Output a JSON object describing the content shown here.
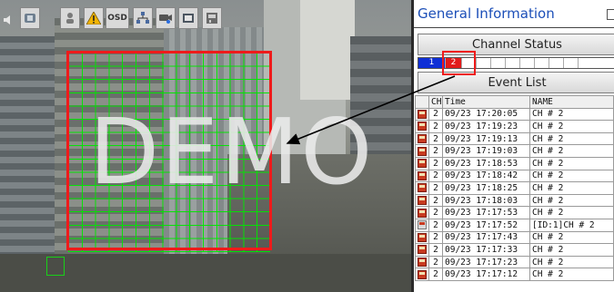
{
  "toolbar": {
    "buttons": [
      {
        "name": "dvr-icon"
      },
      {
        "name": "person-icon"
      },
      {
        "name": "alarm-warning-icon"
      },
      {
        "name": "osd-button",
        "label": "OSD"
      },
      {
        "name": "network-icon"
      },
      {
        "name": "ptz-camera-icon"
      },
      {
        "name": "playback-icon"
      },
      {
        "name": "audio-device-icon"
      }
    ]
  },
  "video": {
    "watermark": "DEMO"
  },
  "panel": {
    "title": "General Information",
    "channel_status": {
      "heading": "Channel Status",
      "channels": [
        "1",
        "2"
      ]
    },
    "event_list": {
      "heading": "Event List",
      "columns": [
        "CH",
        "Time",
        "NAME"
      ],
      "rows": [
        {
          "ch": "2",
          "time": "09/23 17:20:05",
          "name": "CH # 2",
          "icon": "motion"
        },
        {
          "ch": "2",
          "time": "09/23 17:19:23",
          "name": "CH # 2",
          "icon": "motion"
        },
        {
          "ch": "2",
          "time": "09/23 17:19:13",
          "name": "CH # 2",
          "icon": "motion"
        },
        {
          "ch": "2",
          "time": "09/23 17:19:03",
          "name": "CH # 2",
          "icon": "motion"
        },
        {
          "ch": "2",
          "time": "09/23 17:18:53",
          "name": "CH # 2",
          "icon": "motion"
        },
        {
          "ch": "2",
          "time": "09/23 17:18:42",
          "name": "CH # 2",
          "icon": "motion"
        },
        {
          "ch": "2",
          "time": "09/23 17:18:25",
          "name": "CH # 2",
          "icon": "motion"
        },
        {
          "ch": "2",
          "time": "09/23 17:18:03",
          "name": "CH # 2",
          "icon": "motion"
        },
        {
          "ch": "2",
          "time": "09/23 17:17:53",
          "name": "CH # 2",
          "icon": "motion"
        },
        {
          "ch": "2",
          "time": "09/23 17:17:52",
          "name": "[ID:1]CH # 2",
          "icon": "video-loss"
        },
        {
          "ch": "2",
          "time": "09/23 17:17:43",
          "name": "CH # 2",
          "icon": "motion"
        },
        {
          "ch": "2",
          "time": "09/23 17:17:33",
          "name": "CH # 2",
          "icon": "motion"
        },
        {
          "ch": "2",
          "time": "09/23 17:17:23",
          "name": "CH # 2",
          "icon": "motion"
        },
        {
          "ch": "2",
          "time": "09/23 17:17:12",
          "name": "CH # 2",
          "icon": "motion"
        }
      ]
    }
  },
  "colors": {
    "title_blue": "#1c4fb8",
    "channel_active": "#0f2fd6",
    "channel_alarm": "#e21b1b",
    "motion_grid": "#00e600",
    "mask_red": "#ee1b1b"
  }
}
